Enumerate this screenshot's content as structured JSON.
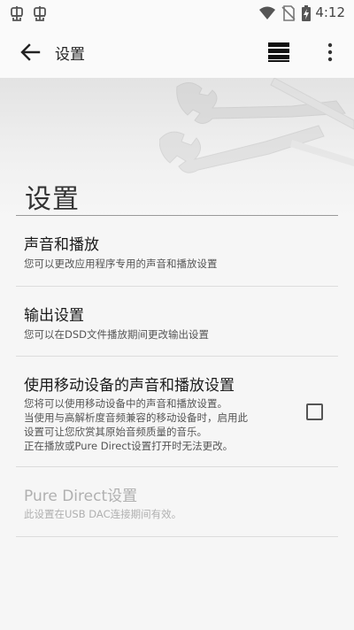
{
  "status_bar": {
    "time": "4:12",
    "icons": [
      "notification-bug-icon",
      "notification-bug-icon",
      "wifi-icon",
      "no-sim-icon",
      "battery-charging-icon"
    ]
  },
  "toolbar": {
    "title": "设置",
    "back_icon": "arrow-left-icon",
    "menu_icon": "menu-lines-icon",
    "overflow_icon": "more-vertical-icon"
  },
  "page": {
    "heading": "设置"
  },
  "prefs": [
    {
      "title": "声音和播放",
      "summary": [
        "您可以更改应用程序专用的声音和播放设置"
      ],
      "enabled": true
    },
    {
      "title": "输出设置",
      "summary": [
        "您可以在DSD文件播放期间更改输出设置"
      ],
      "enabled": true
    },
    {
      "title": "使用移动设备的声音和播放设置",
      "summary": [
        "您将可以使用移动设备中的声音和播放设置。",
        "当使用与高解析度音频兼容的移动设备时，启用此",
        "设置可让您欣赏其原始音频质量的音乐。",
        "正在播放或Pure Direct设置打开时无法更改。"
      ],
      "enabled": true,
      "checked": false
    },
    {
      "title": "Pure Direct设置",
      "summary": [
        "此设置在USB DAC连接期间有效。"
      ],
      "enabled": false
    }
  ],
  "colors": {
    "background": "#f6f6f6",
    "text_primary": "#1a1a1a",
    "text_secondary": "#555555",
    "text_disabled": "#b0b0b0",
    "divider": "#dcdcdc"
  }
}
